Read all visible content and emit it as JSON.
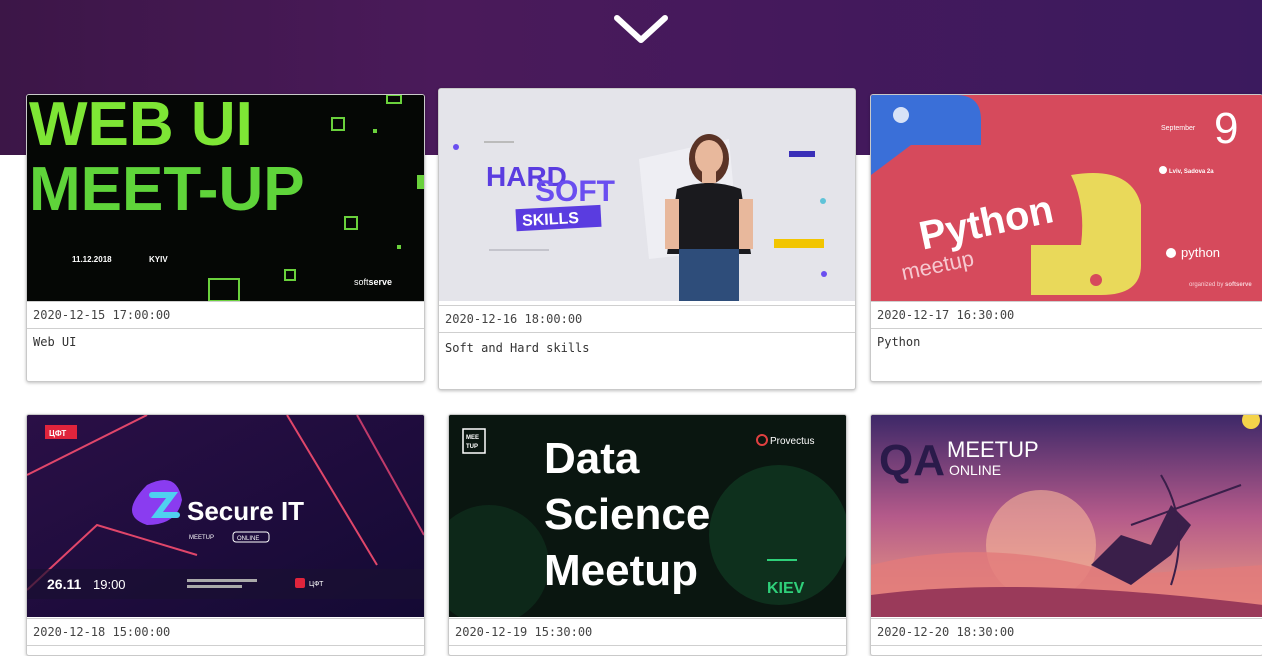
{
  "hero": {
    "icon": "chevron-down-icon"
  },
  "events": [
    {
      "date": "2020-12-15 17:00:00",
      "title": "Web UI",
      "thumb": {
        "line1": "WEB UI",
        "line2": "MEET-UP",
        "date": "11.12.2018",
        "city": "KYIV",
        "brand_a": "soft",
        "brand_b": "serve"
      }
    },
    {
      "date": "2020-12-16 18:00:00",
      "title": "Soft and Hard skills",
      "thumb": {
        "line1": "HARD",
        "line2": "SOFT",
        "line3": "SKILLS"
      }
    },
    {
      "date": "2020-12-17 16:30:00",
      "title": "Python",
      "thumb": {
        "word": "Python",
        "sub": "meetup",
        "day": "9",
        "month": "September",
        "place": "Lviv, Sadova 2a",
        "logo": "python",
        "org_a": "organized by",
        "org_b": "softserve"
      }
    },
    {
      "date": "2020-12-18 15:00:00",
      "title": "",
      "thumb": {
        "tag": "ЦФТ",
        "word": "Secure IT",
        "sub": "MEETUP",
        "badge": "ONLINE",
        "when": "26.11",
        "time": "19:00",
        "brand": "ЦФТ"
      }
    },
    {
      "date": "2020-12-19 15:30:00",
      "title": "",
      "thumb": {
        "line1": "Data",
        "line2": "Science",
        "line3": "Meetup",
        "city": "KIEV",
        "brand": "Provectus",
        "tag1": "MEE",
        "tag2": "TUP"
      }
    },
    {
      "date": "2020-12-20 18:30:00",
      "title": "",
      "thumb": {
        "big": "QA",
        "top": "MEETUP",
        "bottom": "ONLINE"
      }
    }
  ]
}
